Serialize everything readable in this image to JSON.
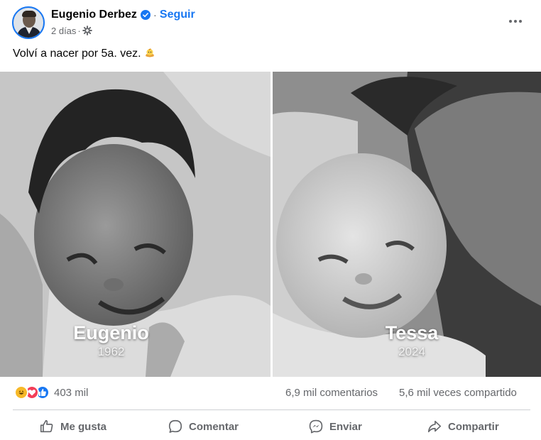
{
  "post": {
    "author": "Eugenio Derbez",
    "separator": "·",
    "follow_label": "Seguir",
    "time": "2 días",
    "meta_separator": "·",
    "caption": "Volví a nacer por 5a. vez.",
    "caption_emoji_icon": "baby-chick-icon"
  },
  "photos": {
    "left": {
      "name": "Eugenio",
      "year": "1962"
    },
    "right": {
      "name": "Tessa",
      "year": "2024"
    }
  },
  "stats": {
    "reaction_icons": [
      "haha-icon",
      "love-icon",
      "like-icon"
    ],
    "reactions": "403 mil",
    "comments": "6,9 mil comentarios",
    "shares": "5,6 mil veces compartido"
  },
  "actions": {
    "like": "Me gusta",
    "comment": "Comentar",
    "send": "Enviar",
    "share": "Compartir"
  },
  "colors": {
    "accent": "#1877f2",
    "text": "#050505",
    "muted": "#65676b",
    "divider": "#ced0d4",
    "haha": "#f7b928",
    "love": "#f33e58",
    "like": "#1877f2"
  }
}
